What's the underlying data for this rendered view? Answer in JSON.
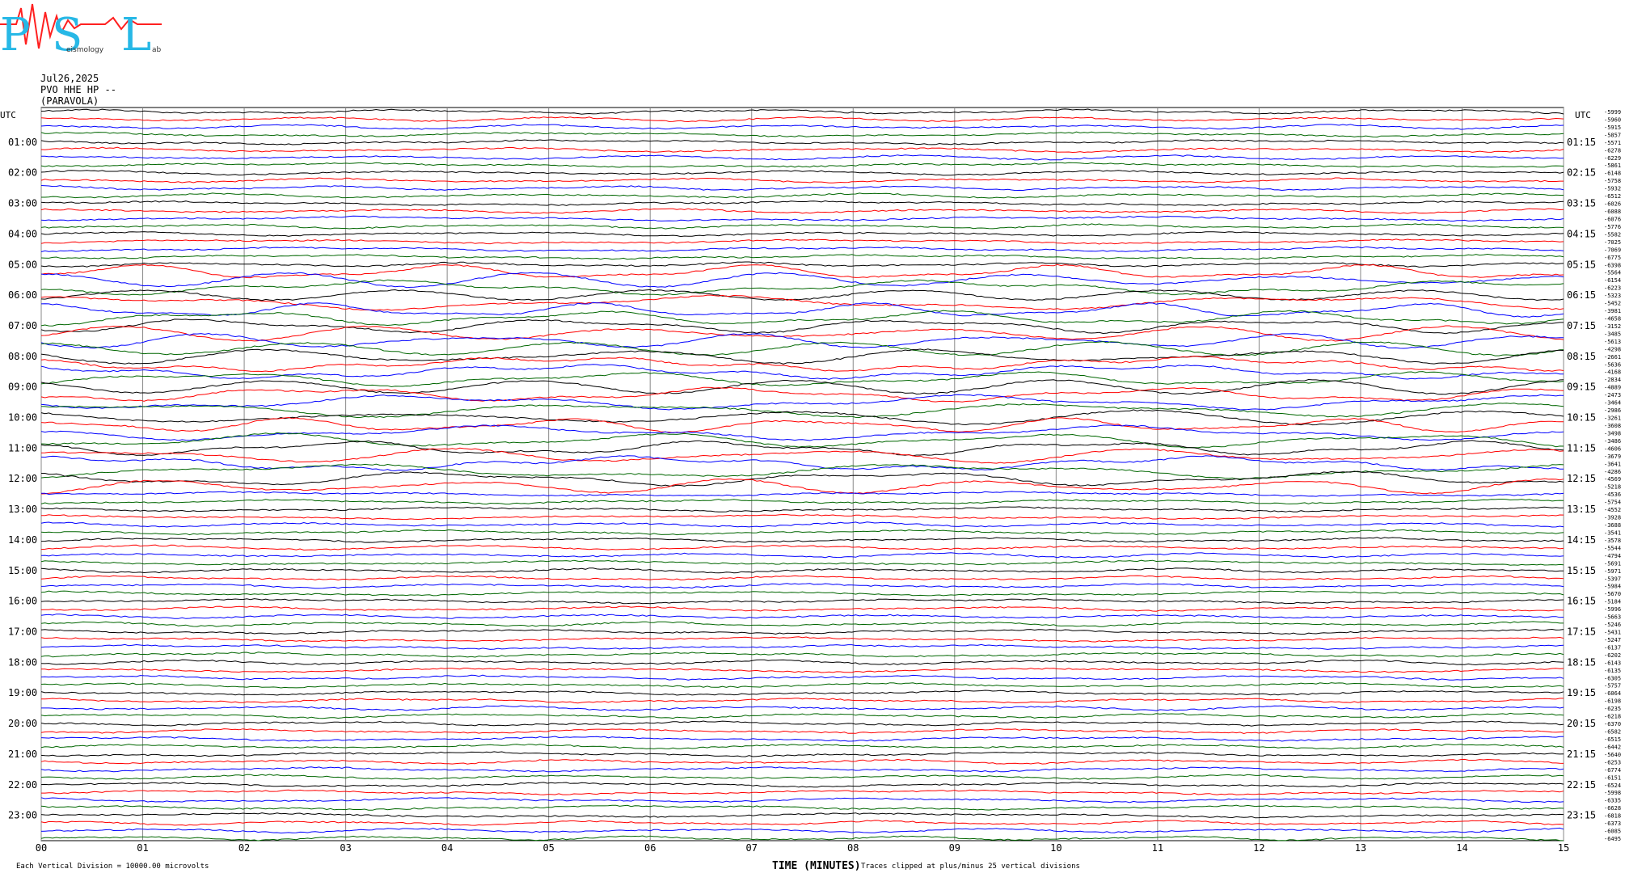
{
  "logo": {
    "text_P": "P",
    "text_S": "S",
    "text_L": "L",
    "sub_eismology": "eismology",
    "sub_ab": "ab"
  },
  "header": {
    "date": "Jul26,2025",
    "station": "PVO HHE HP --",
    "location": "(PARAVOLA)"
  },
  "chart_data": {
    "type": "line",
    "title": "PVO HHE HP -- (PARAVOLA) Jul26,2025",
    "xlabel": "TIME (MINUTES)",
    "xlim": [
      0,
      15
    ],
    "x_ticks": [
      "00",
      "01",
      "02",
      "03",
      "04",
      "05",
      "06",
      "07",
      "08",
      "09",
      "10",
      "11",
      "12",
      "13",
      "14",
      "15"
    ],
    "y_left_header": "UTC",
    "y_right_header": "UTC",
    "left_hour_labels": [
      "01:00",
      "02:00",
      "03:00",
      "04:00",
      "05:00",
      "06:00",
      "07:00",
      "08:00",
      "09:00",
      "10:00",
      "11:00",
      "12:00",
      "13:00",
      "14:00",
      "15:00",
      "16:00",
      "17:00",
      "18:00",
      "19:00",
      "20:00",
      "21:00",
      "22:00",
      "23:00"
    ],
    "right_hour_labels": [
      "01:15",
      "02:15",
      "03:15",
      "04:15",
      "05:15",
      "06:15",
      "07:15",
      "08:15",
      "09:15",
      "10:15",
      "11:15",
      "12:15",
      "13:15",
      "14:15",
      "15:15",
      "16:15",
      "17:15",
      "18:15",
      "19:15",
      "20:15",
      "21:15",
      "22:15",
      "23:15"
    ],
    "trace_colors": [
      "#000000",
      "#ff0000",
      "#0000ff",
      "#006600"
    ],
    "trace_offsets": [
      -5999,
      -5960,
      -5915,
      -5857,
      -5571,
      -6278,
      -6229,
      -5861,
      -6148,
      -5758,
      -5932,
      -6512,
      -6026,
      -6088,
      -6076,
      -5776,
      -5582,
      -7025,
      -7069,
      -6775,
      -6398,
      -5564,
      -6154,
      -6223,
      -5323,
      -5452,
      -3981,
      -4658,
      -3152,
      -3485,
      -5613,
      -4298,
      -2661,
      -5636,
      -4168,
      -2834,
      -4889,
      -2473,
      -3464,
      -2986,
      -3261,
      -3608,
      -3498,
      -3486,
      -4606,
      -3679,
      -3641,
      -4286,
      -4569,
      -5218,
      -4536,
      -5754,
      -4552,
      -3928,
      -3688,
      -3541,
      -3578,
      -5544,
      -4794,
      -5691,
      -5971,
      -5397,
      -5984,
      -5670,
      -5184,
      -5996,
      -5663,
      -5246,
      -5431,
      -5247,
      -6137,
      -6202,
      -6143,
      -6135,
      -6305,
      -5757,
      -6064,
      -6198,
      -6235,
      -6218,
      -6370,
      -6582,
      -6515,
      -6442,
      -5640,
      -6253,
      -6774,
      -6151,
      -6524,
      -5998,
      -6335,
      -6628,
      -6818,
      -6373,
      -6085,
      -6495
    ],
    "traces_per_hour": 4,
    "minutes_per_trace": 15,
    "grid": true,
    "legend_placement": "none",
    "notes": {
      "vertical_division": "Each Vertical Division = 10000.00 microvolts",
      "clipping": "Traces clipped at plus/minus 25 vertical divisions"
    }
  }
}
